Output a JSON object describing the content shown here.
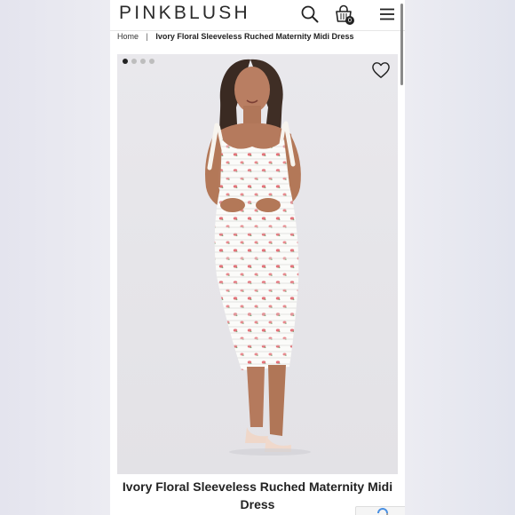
{
  "header": {
    "logo": "PINKBLUSH",
    "cart_count": "0",
    "icons": [
      "search-icon",
      "shopping-bag-icon",
      "menu-icon"
    ]
  },
  "breadcrumb": {
    "home": "Home",
    "separator": "|",
    "current": "Ivory Floral Sleeveless Ruched Maternity Midi Dress"
  },
  "gallery": {
    "image_count": 4,
    "active_index": 0,
    "favorite_icon": "heart-icon"
  },
  "product": {
    "title": "Ivory Floral Sleeveless Ruched Maternity Midi Dress"
  },
  "colors": {
    "accent_dress_print": "#e4737a",
    "text": "#222222"
  }
}
